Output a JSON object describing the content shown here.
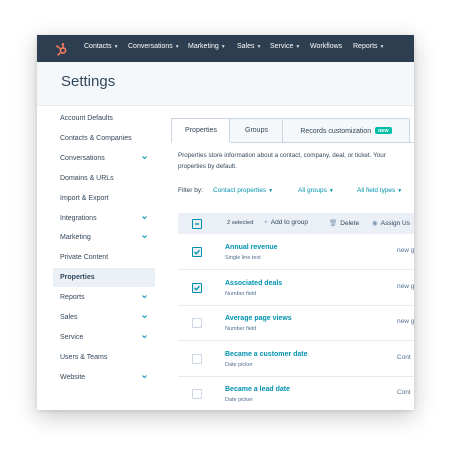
{
  "topnav": {
    "logo": "hubspot-sprocket-icon",
    "items": [
      "Contacts",
      "Conversations",
      "Marketing",
      "Sales",
      "Service",
      "Workflows",
      "Reports"
    ]
  },
  "page": {
    "title": "Settings"
  },
  "sidebar": {
    "items": [
      {
        "label": "Account Defaults",
        "expandable": false
      },
      {
        "label": "Contacts & Companies",
        "expandable": false
      },
      {
        "label": "Conversations",
        "expandable": true
      },
      {
        "label": "Domains & URLs",
        "expandable": false
      },
      {
        "label": "Import & Export",
        "expandable": false
      },
      {
        "label": "Integrations",
        "expandable": true
      },
      {
        "label": "Marketing",
        "expandable": true
      },
      {
        "label": "Private Content",
        "expandable": false
      },
      {
        "label": "Properties",
        "expandable": false,
        "active": true
      },
      {
        "label": "Reports",
        "expandable": true
      },
      {
        "label": "Sales",
        "expandable": true
      },
      {
        "label": "Service",
        "expandable": true
      },
      {
        "label": "Users & Teams",
        "expandable": false
      },
      {
        "label": "Website",
        "expandable": true
      }
    ]
  },
  "tabs": [
    {
      "label": "Properties",
      "active": true
    },
    {
      "label": "Groups"
    },
    {
      "label": "Records customization",
      "badge": "NEW"
    }
  ],
  "description": {
    "line1": "Properties store information about a contact, company, deal, or ticket. Your",
    "line2": "properties by default."
  },
  "filters": {
    "label": "Filter by:",
    "options": [
      "Contact properties",
      "All groups",
      "All field types"
    ]
  },
  "table": {
    "selected_count": "2 selected",
    "actions": {
      "add_to_group": "Add to group",
      "delete": "Delete",
      "assign": "Assign Us"
    },
    "rows": [
      {
        "name": "Annual revenue",
        "type": "Single line text",
        "group": "new g",
        "checked": true
      },
      {
        "name": "Associated deals",
        "type": "Number field",
        "group": "new g",
        "checked": true
      },
      {
        "name": "Average page views",
        "type": "Number field",
        "group": "new g",
        "checked": false
      },
      {
        "name": "Became a customer date",
        "type": "Date picker",
        "group": "Cont",
        "checked": false
      },
      {
        "name": "Became a lead date",
        "type": "Date picker",
        "group": "Cont",
        "checked": false
      }
    ]
  },
  "colors": {
    "nav_bg": "#2d3e50",
    "link": "#0091ae",
    "badge": "#00bda5",
    "logo": "#ff7a59"
  }
}
